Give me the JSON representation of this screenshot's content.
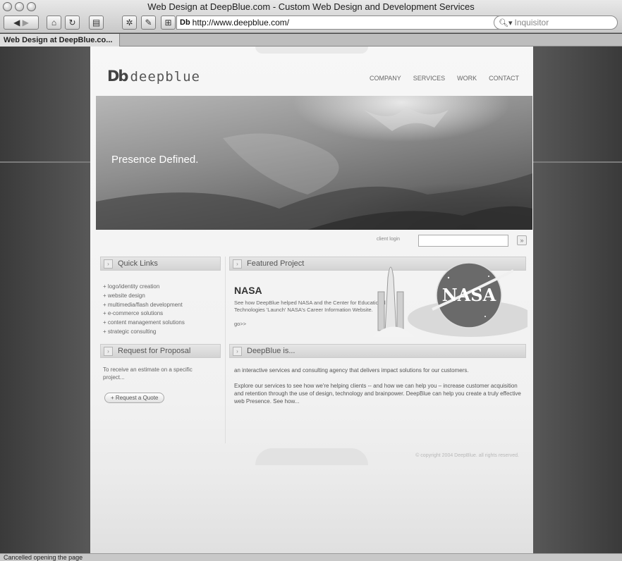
{
  "window": {
    "title": "Web Design at DeepBlue.com - Custom Web Design and Development Services",
    "tab_label": "Web Design at DeepBlue.co...",
    "address": "http://www.deepblue.com/",
    "search_placeholder": "Inquisitor",
    "status": "Cancelled opening the page"
  },
  "site": {
    "logo_mark": "Db",
    "logo_text": "deepblue",
    "nav": [
      "COMPANY",
      "SERVICES",
      "WORK",
      "CONTACT"
    ],
    "hero_text": "Presence Defined.",
    "client_login_label": "client login",
    "go_glyph": "»"
  },
  "quick_links": {
    "heading": "Quick Links",
    "items": [
      "+ logo/identity creation",
      "+ website design",
      "+ multimedia/flash development",
      "+ e-commerce solutions",
      "+ content management solutions",
      "+ strategic consulting"
    ]
  },
  "featured": {
    "heading": "Featured Project",
    "title": "NASA",
    "description": "See how DeepBlue helped NASA and the Center for Educational Technologies 'Launch' NASA's Career Information Website.",
    "more": "go>>",
    "logo_text": "NASA"
  },
  "rfp": {
    "heading": "Request for Proposal",
    "text": "To receive an estimate on a specific project...",
    "button": "+ Request a Quote"
  },
  "about": {
    "heading": "DeepBlue is...",
    "p1": "an interactive services and consulting agency that delivers impact solutions for our customers.",
    "p2": "Explore our services to see how we're helping clients -- and how we can help you – increase customer acquisition and retention through the use of design, technology and brainpower. DeepBlue can help you create a truly effective web Presence. See how...",
    "copyright": "© copyright 2004 DeepBlue. all rights reserved."
  }
}
